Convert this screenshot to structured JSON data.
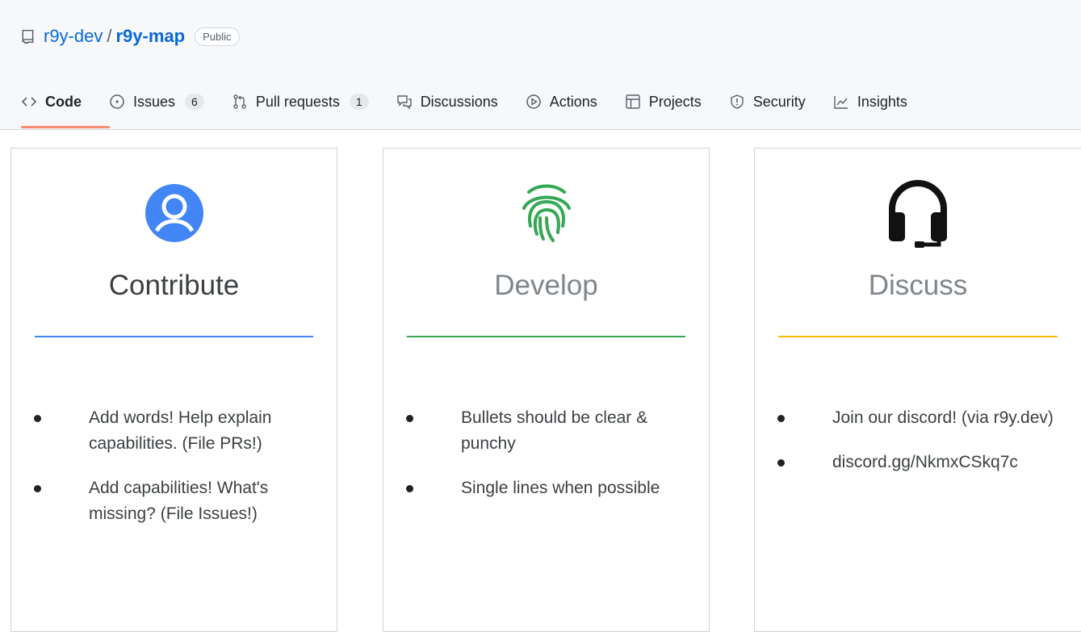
{
  "repo": {
    "owner": "r9y-dev",
    "separator": "/",
    "name": "r9y-map",
    "visibility": "Public"
  },
  "tabs": [
    {
      "label": "Code",
      "icon": "code-icon",
      "active": true
    },
    {
      "label": "Issues",
      "icon": "issue-icon",
      "count": "6"
    },
    {
      "label": "Pull requests",
      "icon": "pull-request-icon",
      "count": "1"
    },
    {
      "label": "Discussions",
      "icon": "discussion-icon"
    },
    {
      "label": "Actions",
      "icon": "play-icon"
    },
    {
      "label": "Projects",
      "icon": "table-icon"
    },
    {
      "label": "Security",
      "icon": "shield-icon"
    },
    {
      "label": "Insights",
      "icon": "graph-icon"
    }
  ],
  "colors": {
    "link": "#0969da",
    "active_tab_underline": "#fd8c73",
    "contribute": "#4285f4",
    "develop": "#34a853",
    "discuss": "#fbbc04"
  },
  "cards": [
    {
      "title": "Contribute",
      "icon": "person-icon",
      "bullets": [
        "Add words!  Help explain capabilities. (File PRs!)",
        "Add capabilities! What's missing? (File Issues!)"
      ]
    },
    {
      "title": "Develop",
      "icon": "fingerprint-icon",
      "bullets": [
        "Bullets should be clear & punchy",
        "Single lines when possible"
      ]
    },
    {
      "title": "Discuss",
      "icon": "headset-icon",
      "bullets": [
        "Join our discord! (via r9y.dev)",
        "discord.gg/NkmxCSkq7c"
      ]
    }
  ]
}
